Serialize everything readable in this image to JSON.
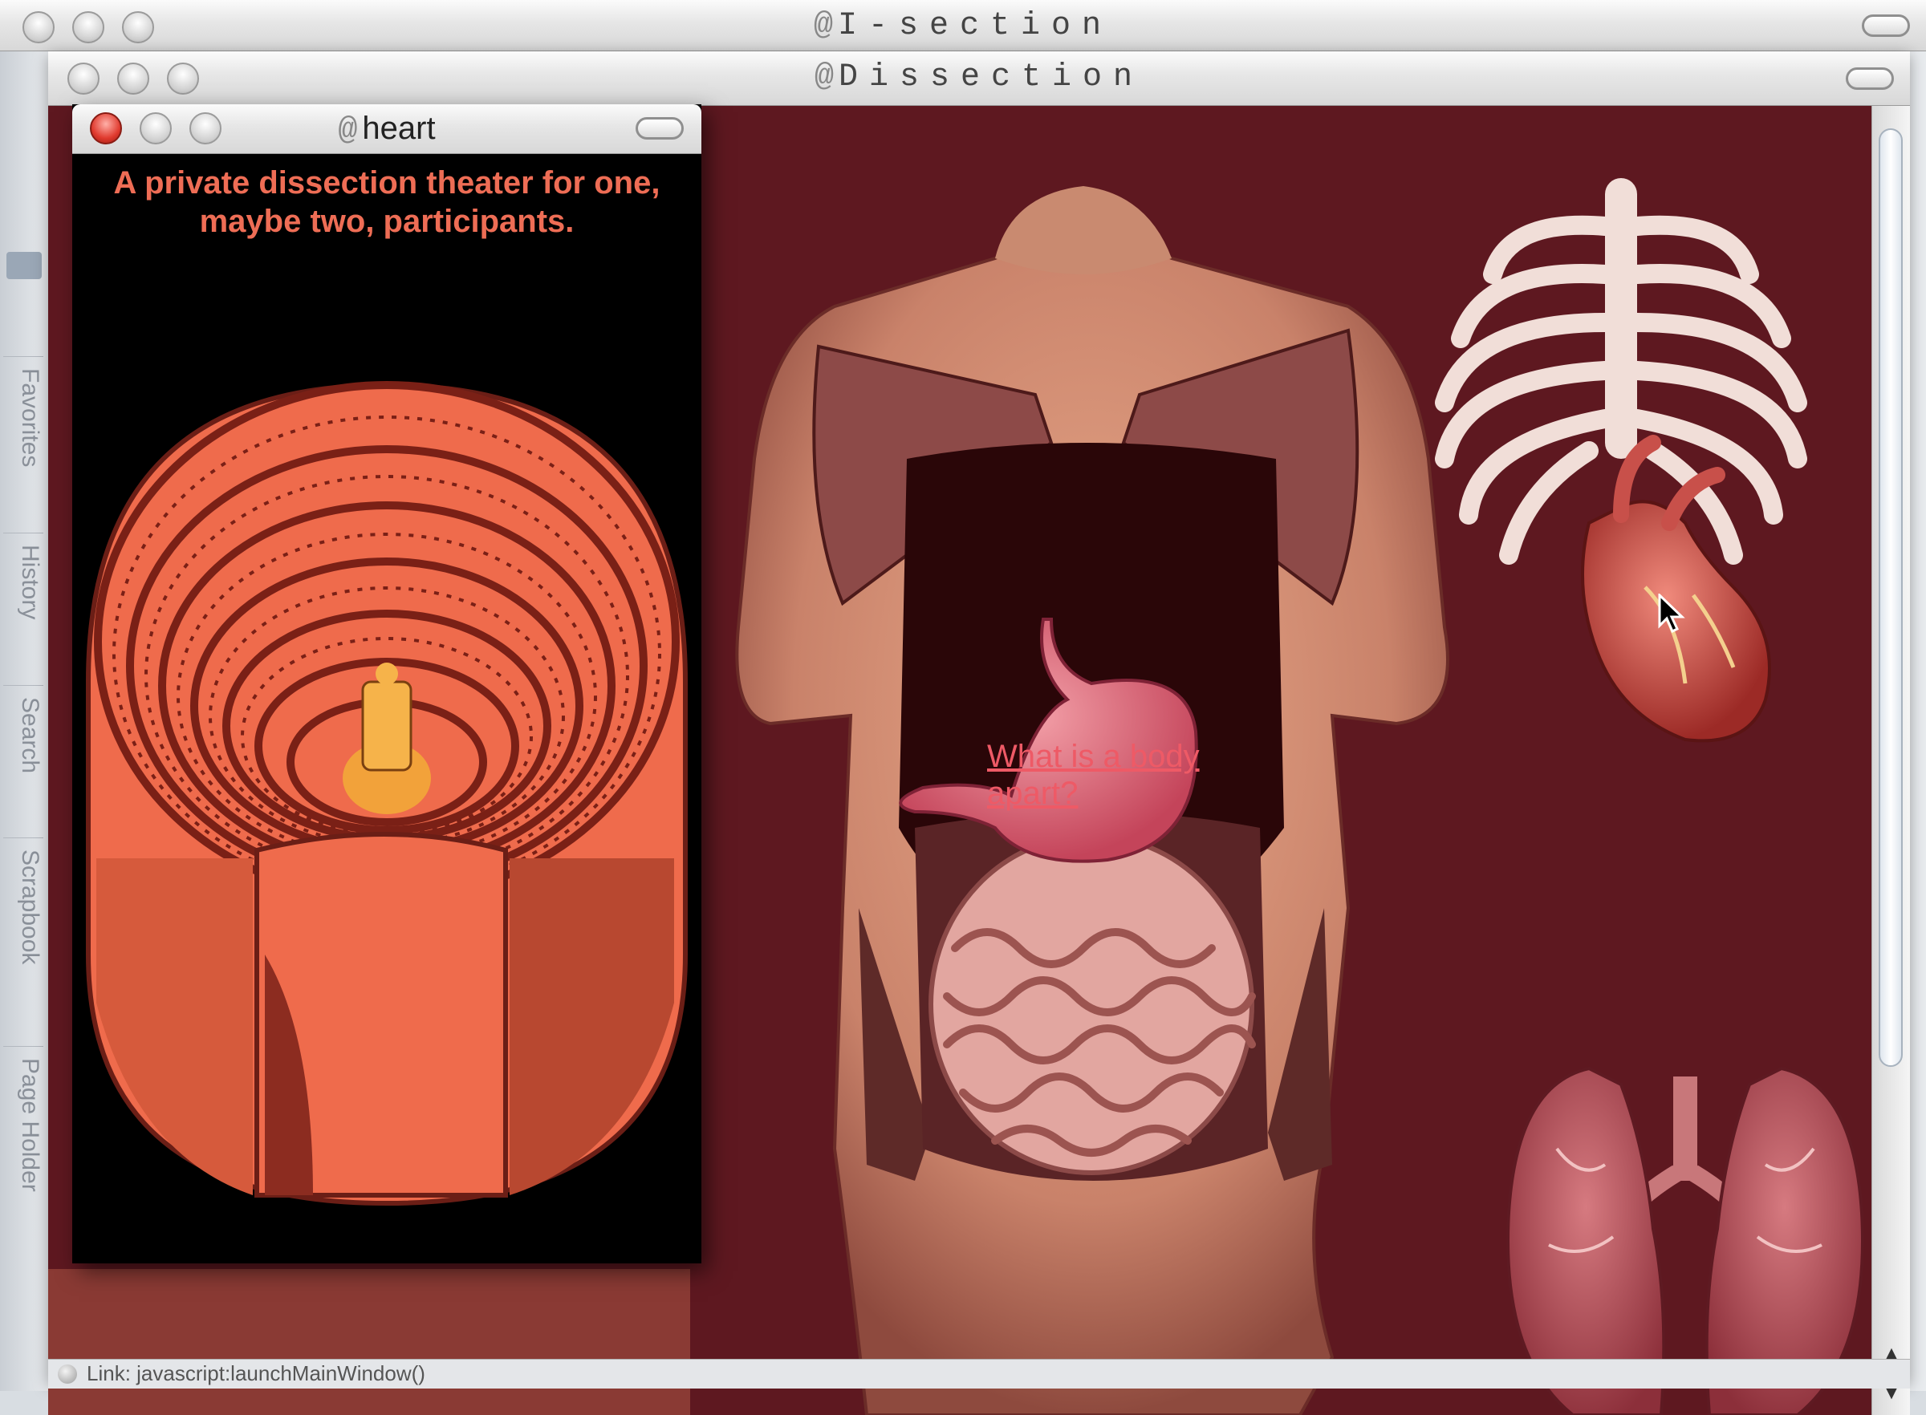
{
  "outer_window": {
    "title": "I-section"
  },
  "sidebar": {
    "tabs": [
      {
        "label": "Favorites"
      },
      {
        "label": "History"
      },
      {
        "label": "Search"
      },
      {
        "label": "Scrapbook"
      },
      {
        "label": "Page Holder"
      }
    ]
  },
  "main_window": {
    "title": "Dissection"
  },
  "popup_window": {
    "title": "heart",
    "tagline": "A private dissection theater for one, maybe two, participants."
  },
  "content": {
    "link_text": "What is a body apart?",
    "images": [
      "dissection-theater-engraving",
      "torso-illustration",
      "ribcage",
      "heart",
      "lungs"
    ]
  },
  "statusbar": {
    "text": "Link: javascript:launchMainWindow()"
  },
  "colors": {
    "background": "#5e1820",
    "theater": "#ef6b4c",
    "tagline": "#ee6d55",
    "link": "#ee5a66"
  }
}
